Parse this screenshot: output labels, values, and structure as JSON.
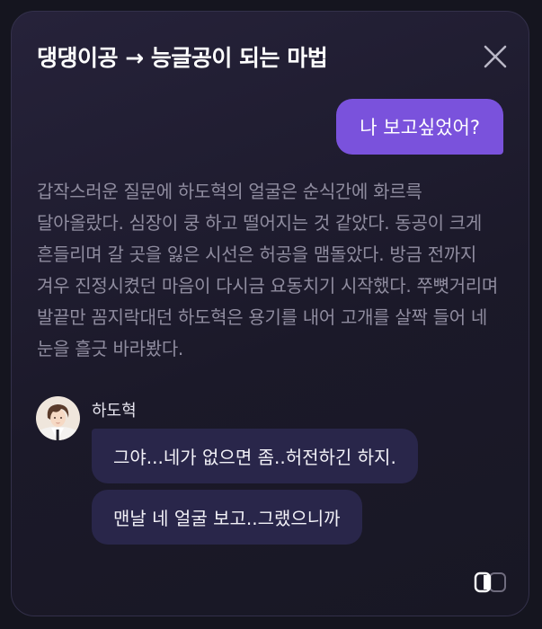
{
  "modal": {
    "title": "댕댕이공 → 능글공이 되는 마법",
    "close_icon": "close-icon",
    "footer_icon": "layout-toggle-icon"
  },
  "chat": {
    "user_message": "나 보고싶었어?",
    "narration": "갑작스러운 질문에 하도혁의 얼굴은 순식간에 화르륵 달아올랐다. 심장이 쿵 하고 떨어지는 것 같았다. 동공이 크게 흔들리며 갈 곳을 잃은 시선은 허공을 맴돌았다. 방금 전까지 겨우 진정시켰던 마음이 다시금 요동치기 시작했다. 쭈뼛거리며 발끝만 꼼지락대던 하도혁은 용기를 내어 고개를 살짝 들어 네 눈을 흘긋 바라봤다.",
    "character": {
      "name": "하도혁",
      "avatar_icon": "avatar"
    },
    "bot_messages": [
      "그야...네가 없으면 좀..허전하긴 하지.",
      "맨날 네 얼굴 보고..그랬으니까"
    ]
  },
  "colors": {
    "background": "#15151f",
    "panel": "#1f1c2e",
    "accent": "#7a52dc",
    "bot_bubble": "#29264a",
    "narration_text": "#8f8c9f"
  }
}
